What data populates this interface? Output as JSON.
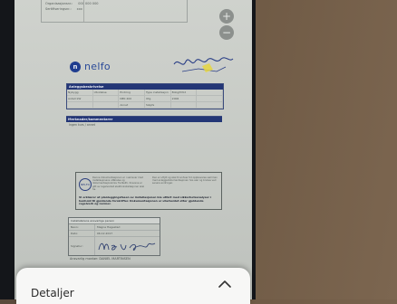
{
  "document": {
    "topform": {
      "rows": [
        {
          "label": "Organisasjonsnr.:",
          "value": "000 000 000"
        },
        {
          "label": "Sertifiseringsnr.:",
          "value": "xxx"
        }
      ]
    },
    "brand": {
      "mark": "n",
      "name": "nelfo"
    },
    "section1": {
      "title": "Anleggsbeskrivelse",
      "cells": [
        "Nybygg",
        "Utvidelse",
        "Endring",
        "Type installasjon",
        "Bolig/fritid",
        "",
        "Antall kW",
        "",
        "NEK 400",
        "Utg.",
        "2006",
        "",
        "",
        "",
        "Annet",
        "Sløyfe",
        "",
        ""
      ]
    },
    "section2": {
      "title": "Merknader/kommentarer",
      "text": "Ingen kurs / annet"
    },
    "declaration": {
      "seal_text": "NELFO",
      "fine_left": "Denne dokumentasjonen er i samsvar med installasjonens utførelse og dokumentasjonskrav fra Nelfo. Kravene er gitt av regelverket elektroinstallasjoner skal ha.",
      "fine_right": "Den er utfylt og skal til enhver tid oppbevares sammen med anleggsdokumentasjonen hos eier og brukes ved senere endringer.",
      "bold_text": "Vi erklærer at planleggingsfasen av installasjonen ble utført med sikkerhetsanalyser i henhold til gjeldende forskrifter. Dokumentasjonen er utarbeidet etter gjeldende regelverk og normer."
    },
    "signature_table": {
      "header": "Installatørens ansvarlige person",
      "rows": [
        {
          "label": "Navn:",
          "value": "Magne Hagestad"
        },
        {
          "label": "Dato:",
          "value": "06.12.2017"
        }
      ],
      "sig_label": "Signatur:"
    },
    "footer": "Ansvarlig montør: DANIEL MARTINSEN"
  },
  "bottom_sheet": {
    "title": "Detaljer",
    "chevron_icon": "chevron-up-icon"
  },
  "fab_icons": [
    "plus-icon",
    "minus-icon"
  ],
  "colors": {
    "brand_blue": "#233676",
    "sheet_bg": "#f7f7f6"
  }
}
